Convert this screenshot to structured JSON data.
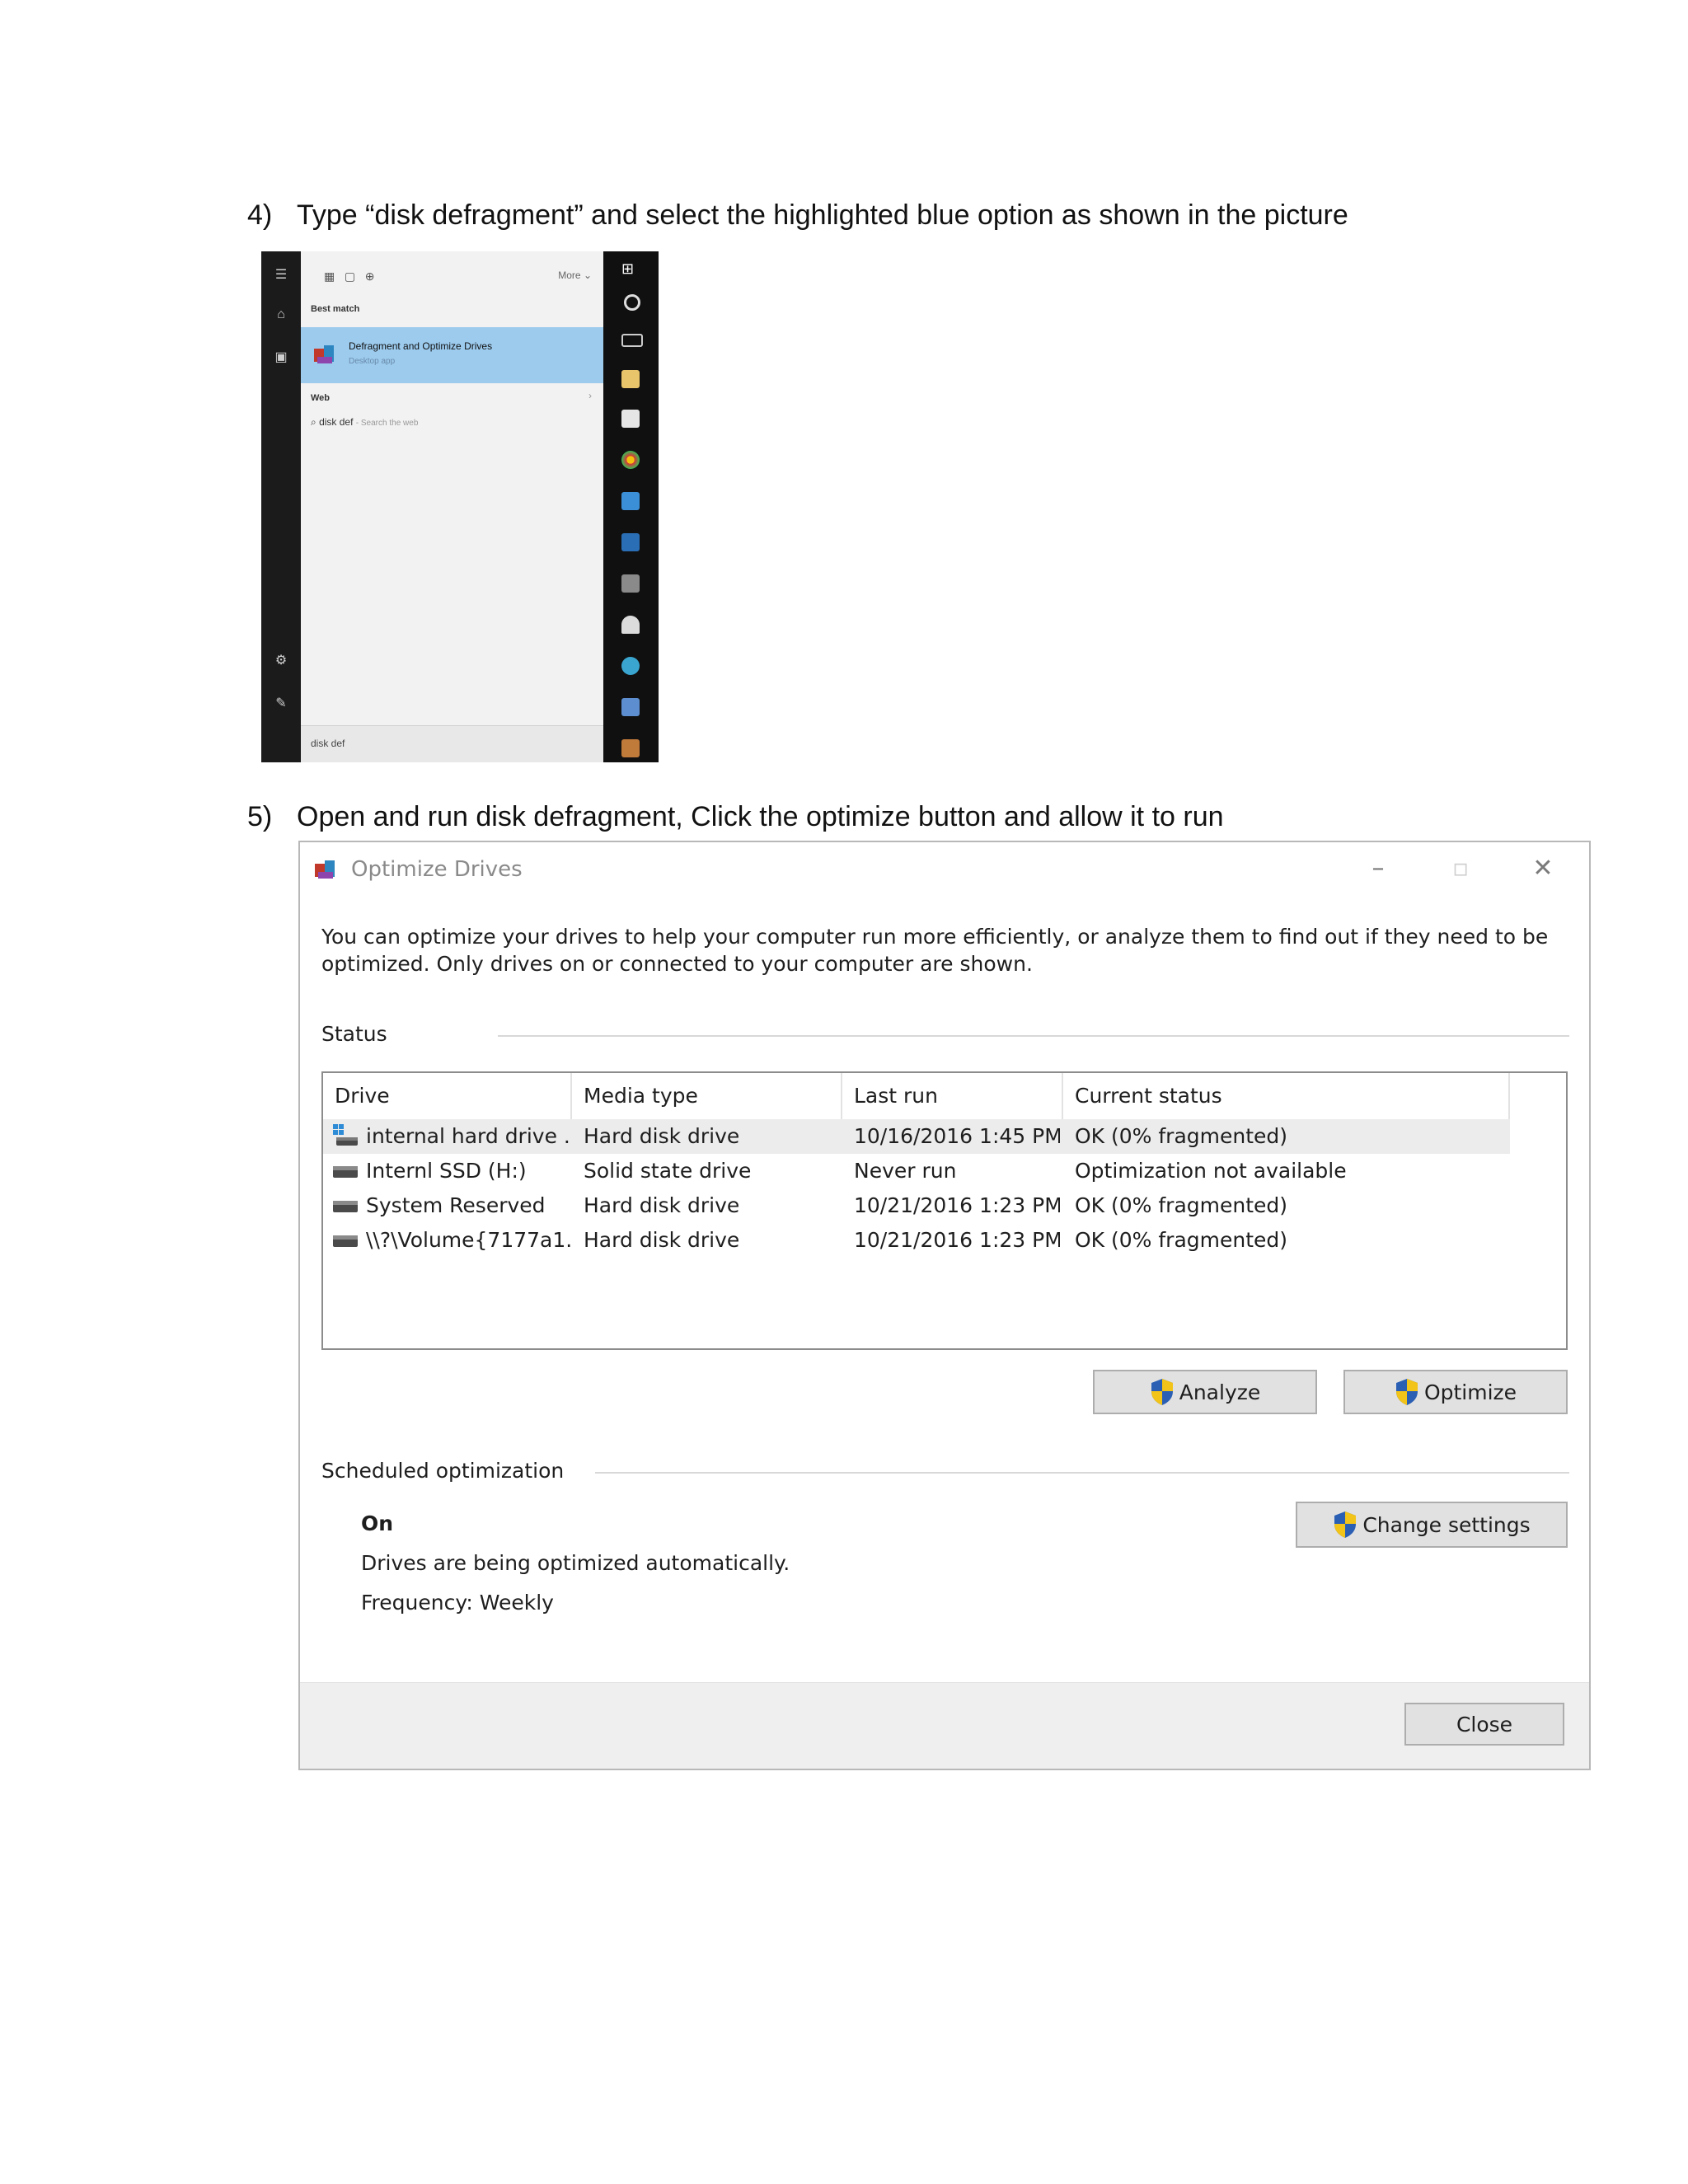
{
  "steps": [
    {
      "number": "4)",
      "text": "Type “disk defragment”  and select the highlighted blue option as shown in the picture"
    },
    {
      "number": "5)",
      "text": "Open and run disk defragment, Click the optimize button and allow it to run"
    }
  ],
  "start_menu": {
    "more_label": "More",
    "best_match_label": "Best match",
    "best_match_title": "Defragment and Optimize Drives",
    "best_match_subtitle": "Desktop app",
    "web_label": "Web",
    "web_query": "disk def",
    "web_hint": "- Search the web",
    "search_box_text": "disk def",
    "highlight_color": "#9ccbee"
  },
  "window": {
    "title": "Optimize Drives",
    "description_line1": "You can optimize your drives to help your computer run more efficiently, or analyze them to find out if they need to be",
    "description_line2": "optimized. Only drives on or connected to your computer are shown.",
    "status_label": "Status",
    "columns": [
      "Drive",
      "Media type",
      "Last run",
      "Current status"
    ],
    "drives": [
      {
        "drive": "internal hard drive ...",
        "media_type": "Hard disk drive",
        "last_run": "10/16/2016 1:45 PM",
        "status": "OK (0% fragmented)",
        "icon": "windows-drive-icon"
      },
      {
        "drive": "Internl SSD (H:)",
        "media_type": "Solid state drive",
        "last_run": "Never run",
        "status": "Optimization not available",
        "icon": "drive-icon"
      },
      {
        "drive": "System Reserved",
        "media_type": "Hard disk drive",
        "last_run": "10/21/2016 1:23 PM",
        "status": "OK (0% fragmented)",
        "icon": "drive-icon"
      },
      {
        "drive": "\\\\?\\Volume{7177a1...",
        "media_type": "Hard disk drive",
        "last_run": "10/21/2016 1:23 PM",
        "status": "OK (0% fragmented)",
        "icon": "drive-icon"
      }
    ],
    "analyze_label": "Analyze",
    "optimize_label": "Optimize",
    "scheduled_label": "Scheduled optimization",
    "schedule_state": "On",
    "schedule_desc": "Drives are being optimized automatically.",
    "schedule_freq": "Frequency: Weekly",
    "change_settings_label": "Change settings",
    "close_label": "Close"
  }
}
